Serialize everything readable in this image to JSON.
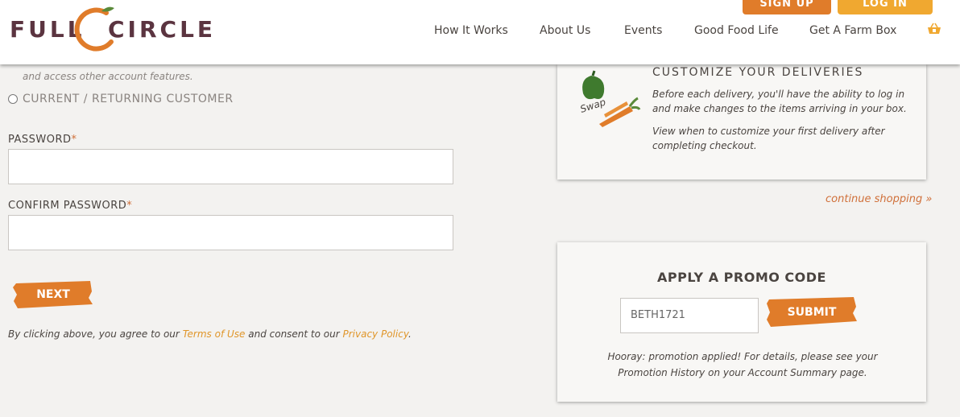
{
  "brand": {
    "logo_word1": "FULL",
    "logo_word2": "CIRCLE",
    "accent": "#e07c2a",
    "logo_color": "#5b3440"
  },
  "header": {
    "signup_label": "SIGN UP",
    "login_label": "LOG IN",
    "nav": [
      "How It Works",
      "About Us",
      "Events",
      "Good Food Life",
      "Get A Farm Box"
    ],
    "cart_icon": "basket-icon"
  },
  "form": {
    "account_note": "and access other account features.",
    "returning_label": "CURRENT / RETURNING CUSTOMER",
    "password_label": "PASSWORD",
    "confirm_label": "CONFIRM PASSWORD",
    "required_mark": "*",
    "password_value": "",
    "confirm_value": "",
    "next_label": "NEXT",
    "legal_prefix": "By clicking above, you agree to our",
    "terms_link": "Terms of Use",
    "legal_middle": "and consent to our",
    "privacy_link": "Privacy Policy",
    "legal_suffix": "."
  },
  "customize": {
    "title": "CUSTOMIZE YOUR DELIVERIES",
    "p1": "Before each delivery, you'll have the ability to log in and make changes to the items arriving in your box.",
    "p2": "View when to customize your first delivery after completing checkout.",
    "swap_word": "Swap"
  },
  "continue_link": "continue shopping »",
  "promo": {
    "title": "APPLY A PROMO CODE",
    "code_value": "BETH1721",
    "submit_label": "SUBMIT",
    "message": "Hooray: promotion applied! For details, please see your Promotion History on your Account Summary page."
  }
}
